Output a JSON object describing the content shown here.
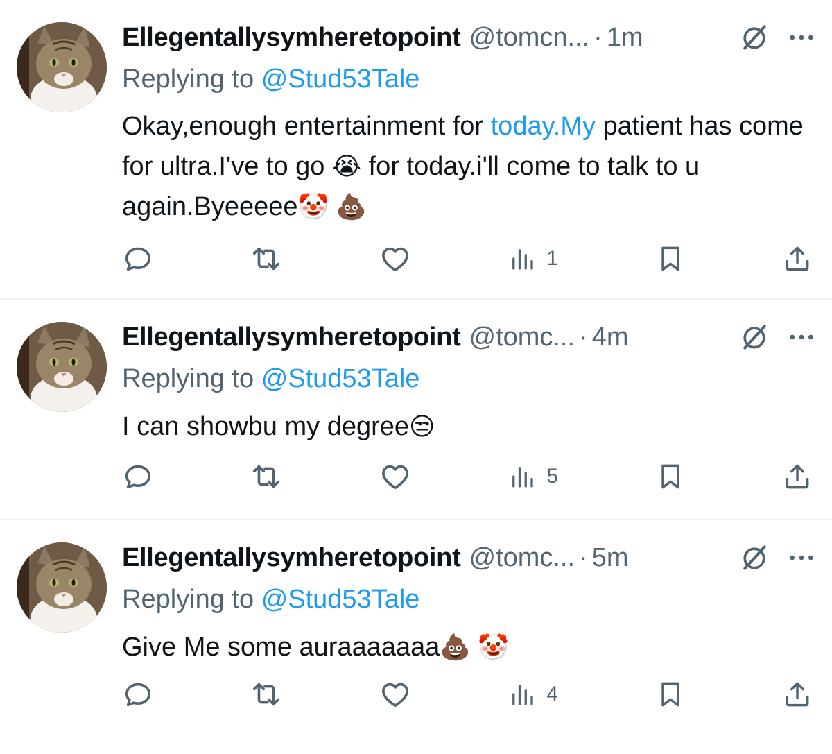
{
  "tweets": [
    {
      "name": "Ellegentallysymheretopoint",
      "handle": "@tomcn...",
      "time": "1m",
      "reply_prefix": "Replying to",
      "reply_to": "@Stud53Tale",
      "text_part1": "Okay,enough entertainment for ",
      "text_link": "today.My",
      "text_part2": " patient has come for ultra.I've to go ",
      "emoji1": "😭",
      "text_part3": "  for today.i'll come to talk to u again.Byeeeee",
      "emoji2": "🤡",
      "emoji3": " 💩",
      "views": "1"
    },
    {
      "name": "Ellegentallysymheretopoint",
      "handle": "@tomc...",
      "time": "4m",
      "reply_prefix": "Replying to",
      "reply_to": "@Stud53Tale",
      "text_part1": "I can showbu my degree",
      "emoji1": "😒",
      "views": "5"
    },
    {
      "name": "Ellegentallysymheretopoint",
      "handle": "@tomc...",
      "time": "5m",
      "reply_prefix": "Replying to",
      "reply_to": "@Stud53Tale",
      "text_part1": "Give Me some auraaaaaaa",
      "emoji1": "💩",
      "emoji2": " 🤡",
      "views": "4"
    }
  ],
  "icons": {
    "reply": "reply-icon",
    "retweet": "retweet-icon",
    "like": "heart-icon",
    "views": "views-chart-icon",
    "bookmark": "bookmark-icon",
    "share": "share-icon",
    "grok": "grok-icon",
    "more": "more-dots-icon"
  },
  "colors": {
    "accent": "#1d9bf0",
    "secondary_text": "#536471",
    "divider": "#eff3f4"
  }
}
